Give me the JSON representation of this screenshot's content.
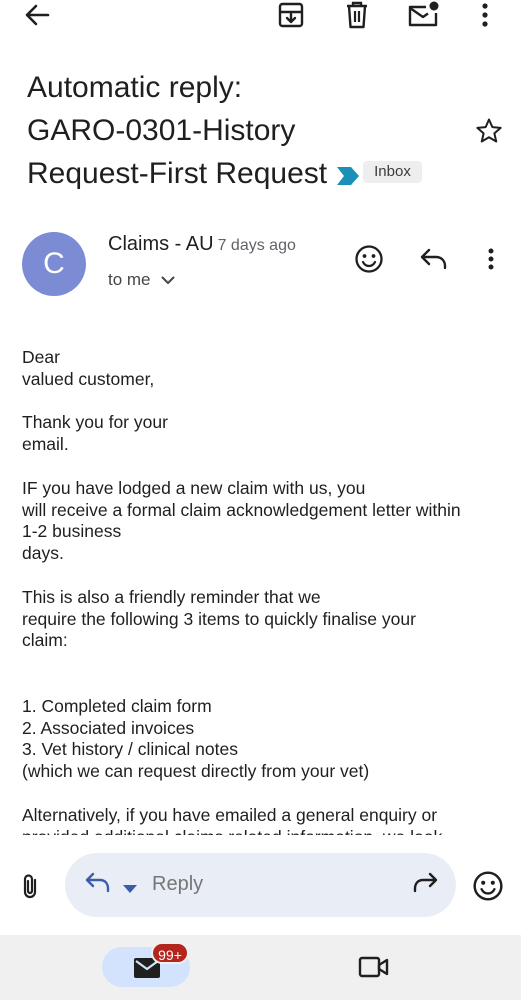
{
  "topbar": {
    "icons": [
      "back-arrow-icon",
      "archive-icon",
      "delete-icon",
      "mark-unread-icon",
      "more-vert-icon"
    ]
  },
  "subject": {
    "line1": "Automatic reply:",
    "line2": "GARO-0301-History",
    "line3": "Request-First Request",
    "label": "Inbox",
    "important_color": "#1a8fb8"
  },
  "sender": {
    "avatar_letter": "C",
    "avatar_color": "#7b8cd4",
    "name": "Claims - AU",
    "time": "7 days ago",
    "recipient": "to me"
  },
  "body": {
    "paragraphs": [
      "Dear\nvalued customer,",
      "Thank you for your\nemail.",
      "IF you have lodged a new claim with us, you\nwill receive a formal claim acknowledgement letter within\n1-2 business\ndays.",
      "This is also a friendly reminder that we\nrequire the following 3 items to quickly finalise your\nclaim:",
      "1. Completed claim form\n2. Associated invoices\n3. Vet history / clinical notes\n(which we can request directly from your vet)",
      "Alternatively, if you have emailed a general enquiry or\nprovided additional claims related information, we look"
    ]
  },
  "reply_bar": {
    "placeholder": "Reply"
  },
  "bottom_nav": {
    "mail_badge": "99+",
    "accent": "#d3e3fd"
  }
}
